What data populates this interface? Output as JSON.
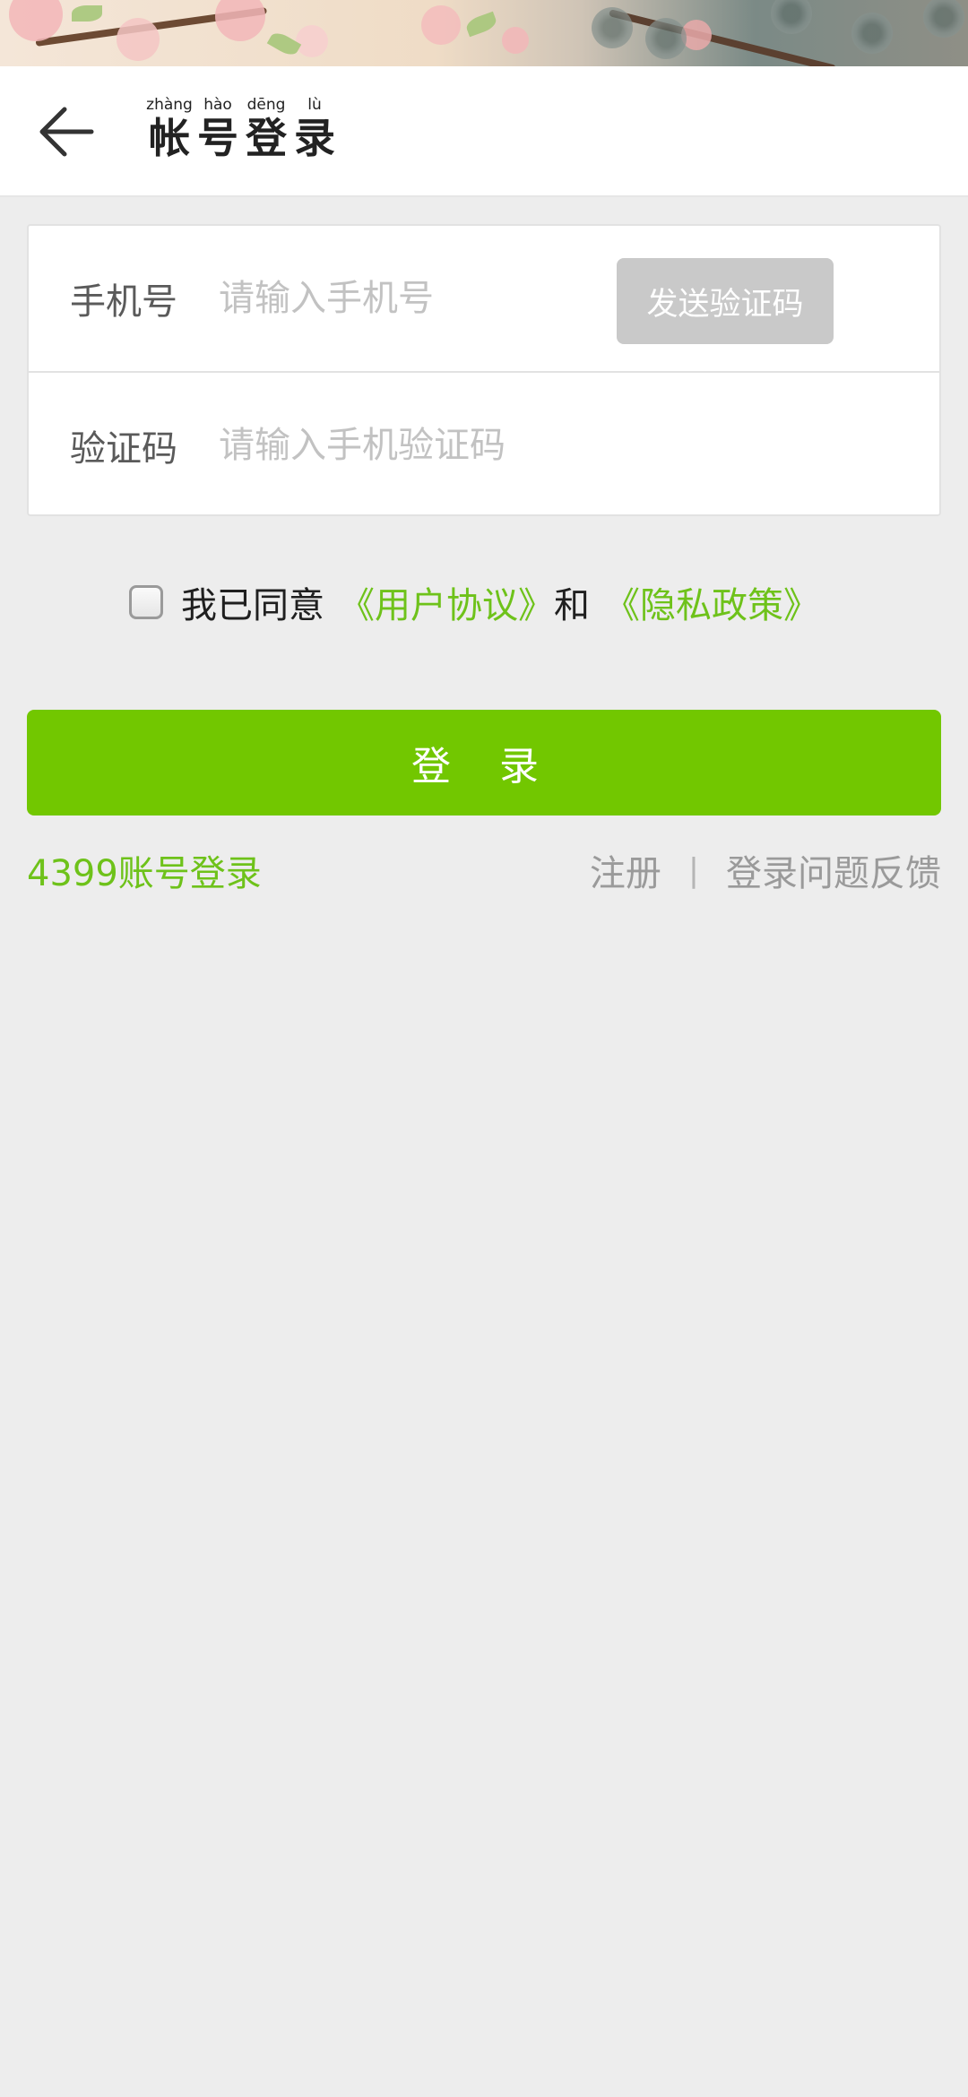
{
  "header": {
    "title_chars": [
      {
        "pinyin": "zhàng",
        "char": "帐"
      },
      {
        "pinyin": "hào",
        "char": "号"
      },
      {
        "pinyin": "dēng",
        "char": "登"
      },
      {
        "pinyin": "lù",
        "char": "录"
      }
    ],
    "back_icon": "arrow-left-icon"
  },
  "form": {
    "phone": {
      "label": "手机号",
      "placeholder": "请输入手机号",
      "value": ""
    },
    "send_code_label": "发送验证码",
    "code": {
      "label": "验证码",
      "placeholder": "请输入手机验证码",
      "value": ""
    }
  },
  "agreement": {
    "checked": false,
    "prefix": "我已同意",
    "user_agreement": "《用户协议》",
    "conjunction": "和",
    "privacy_policy": "《隐私政策》"
  },
  "login_button_label": "登 录",
  "footer": {
    "alt_login": "4399账号登录",
    "register": "注册",
    "separator": "|",
    "feedback": "登录问题反馈"
  },
  "colors": {
    "accent_green": "#72c700",
    "link_green": "#6ec21a",
    "disabled_button": "#c9c9c9",
    "background": "#ededed"
  }
}
